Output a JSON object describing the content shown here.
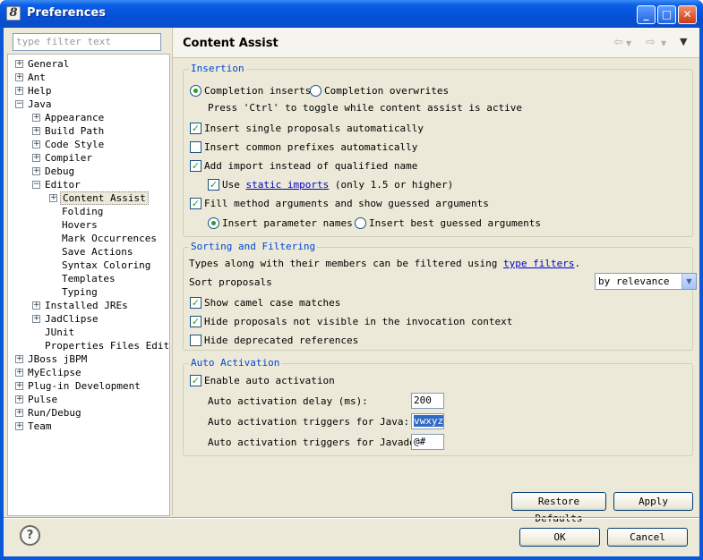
{
  "window": {
    "title": "Preferences",
    "icon_glyph": "8"
  },
  "titlebar_buttons": {
    "minimize": "_",
    "maximize": "□",
    "close": "✕"
  },
  "filter": {
    "placeholder": "type filter text"
  },
  "tree": [
    {
      "label": "General",
      "level": 0,
      "expander": "+"
    },
    {
      "label": "Ant",
      "level": 0,
      "expander": "+"
    },
    {
      "label": "Help",
      "level": 0,
      "expander": "+"
    },
    {
      "label": "Java",
      "level": 0,
      "expander": "−"
    },
    {
      "label": "Appearance",
      "level": 1,
      "expander": "+"
    },
    {
      "label": "Build Path",
      "level": 1,
      "expander": "+"
    },
    {
      "label": "Code Style",
      "level": 1,
      "expander": "+"
    },
    {
      "label": "Compiler",
      "level": 1,
      "expander": "+"
    },
    {
      "label": "Debug",
      "level": 1,
      "expander": "+"
    },
    {
      "label": "Editor",
      "level": 1,
      "expander": "−"
    },
    {
      "label": "Content Assist",
      "level": 2,
      "expander": "+",
      "selected": true
    },
    {
      "label": "Folding",
      "level": 2,
      "expander": ""
    },
    {
      "label": "Hovers",
      "level": 2,
      "expander": ""
    },
    {
      "label": "Mark Occurrences",
      "level": 2,
      "expander": ""
    },
    {
      "label": "Save Actions",
      "level": 2,
      "expander": ""
    },
    {
      "label": "Syntax Coloring",
      "level": 2,
      "expander": ""
    },
    {
      "label": "Templates",
      "level": 2,
      "expander": ""
    },
    {
      "label": "Typing",
      "level": 2,
      "expander": ""
    },
    {
      "label": "Installed JREs",
      "level": 1,
      "expander": "+"
    },
    {
      "label": "JadClipse",
      "level": 1,
      "expander": "+"
    },
    {
      "label": "JUnit",
      "level": 1,
      "expander": ""
    },
    {
      "label": "Properties Files Edit",
      "level": 1,
      "expander": ""
    },
    {
      "label": "JBoss jBPM",
      "level": 0,
      "expander": "+"
    },
    {
      "label": "MyEclipse",
      "level": 0,
      "expander": "+"
    },
    {
      "label": "Plug-in Development",
      "level": 0,
      "expander": "+"
    },
    {
      "label": "Pulse",
      "level": 0,
      "expander": "+"
    },
    {
      "label": "Run/Debug",
      "level": 0,
      "expander": "+"
    },
    {
      "label": "Team",
      "level": 0,
      "expander": "+"
    }
  ],
  "page": {
    "title": "Content Assist",
    "nav_back": "⇦",
    "nav_forward": "⇨",
    "nav_menu": "▼"
  },
  "insertion": {
    "label": "Insertion",
    "completion_inserts": "Completion inserts",
    "completion_overwrites": "Completion overwrites",
    "hint": "Press 'Ctrl' to toggle while content assist is active",
    "insert_single": "Insert single proposals automatically",
    "insert_prefixes": "Insert common prefixes automatically",
    "add_import": "Add import instead of qualified name",
    "use": "Use",
    "static_imports": "static imports",
    "static_suffix": "(only 1.5 or higher)",
    "fill_args": "Fill method arguments and show guessed arguments",
    "insert_param_names": "Insert parameter names",
    "insert_best_guessed": "Insert best guessed arguments"
  },
  "sorting": {
    "label": "Sorting and Filtering",
    "types_text": "Types along with their members can be filtered using",
    "type_filters": "type filters",
    "period": ".",
    "sort_proposals": "Sort proposals",
    "sort_value": "by relevance",
    "camel_case": "Show camel case matches",
    "hide_not_visible": "Hide proposals not visible in the invocation context",
    "hide_deprecated": "Hide deprecated references"
  },
  "auto": {
    "label": "Auto Activation",
    "enable": "Enable auto activation",
    "delay_label": "Auto activation delay (ms):",
    "delay_value": "200",
    "java_label": "Auto activation triggers for Java:",
    "java_value": "vwxyz",
    "javadoc_label": "Auto activation triggers for Javadoc:",
    "javadoc_value": "@#"
  },
  "buttons": {
    "restore": "Restore Defaults",
    "apply": "Apply",
    "ok": "OK",
    "cancel": "Cancel",
    "help": "?"
  },
  "check_mark": "✓",
  "scroll": {
    "left": "◀",
    "right": "▶",
    "grip": "|||"
  }
}
